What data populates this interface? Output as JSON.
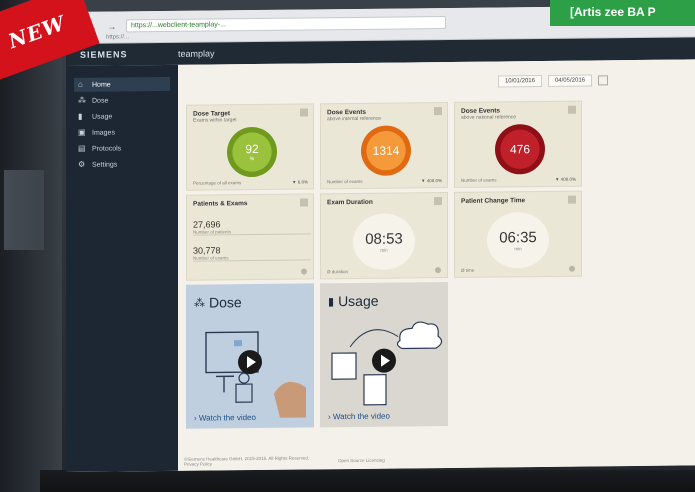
{
  "overlay": {
    "badge": "NEW",
    "tagline": "[Artis zee BA P"
  },
  "browser": {
    "nav": "← → C",
    "url": "https://...webclient-teamplay-...",
    "tab_label": "https://..."
  },
  "app": {
    "brand": "SIEMENS",
    "product": "teamplay"
  },
  "sidebar": {
    "items": [
      {
        "label": "Home",
        "icon": "home-icon",
        "active": true
      },
      {
        "label": "Dose",
        "icon": "dose-icon"
      },
      {
        "label": "Usage",
        "icon": "bar-chart-icon"
      },
      {
        "label": "Images",
        "icon": "images-icon"
      },
      {
        "label": "Protocols",
        "icon": "protocols-icon"
      },
      {
        "label": "Settings",
        "icon": "gear-icon"
      }
    ]
  },
  "datebar": {
    "from": "10/01/2016",
    "to": "04/05/2016"
  },
  "tiles": {
    "dose_target": {
      "title": "Dose Target",
      "sub": "Exams within target",
      "value": "92",
      "unit": "%",
      "foot": "Percentage of all exams",
      "trend": "▼ 6.8%"
    },
    "dose_events_orange": {
      "title": "Dose Events",
      "sub": "above internal reference",
      "value": "1314",
      "foot": "Number of exams",
      "trend": "▼ 408.0%"
    },
    "dose_events_red": {
      "title": "Dose Events",
      "sub": "above national reference",
      "value": "476",
      "foot": "Number of exams",
      "trend": "▼ 408.0%"
    },
    "patients_exams": {
      "title": "Patients & Exams",
      "patients_num": "27,696",
      "patients_lbl": "Number of patients",
      "exams_num": "30,778",
      "exams_lbl": "Number of exams"
    },
    "exam_duration": {
      "title": "Exam Duration",
      "value": "08:53",
      "unit": "min",
      "foot": "Ø duration"
    },
    "patient_change": {
      "title": "Patient Change Time",
      "value": "06:35",
      "unit": "min",
      "foot": "Ø time"
    }
  },
  "videos": {
    "dose": {
      "title": "Dose",
      "link": "› Watch the video"
    },
    "usage": {
      "title": "Usage",
      "link": "› Watch the video"
    }
  },
  "footer": {
    "copyright": "©Siemens Healthcare GmbH, 2015-2016. All Rights Reserved.",
    "privacy": "Privacy Policy",
    "license": "Open Source Licensing"
  }
}
